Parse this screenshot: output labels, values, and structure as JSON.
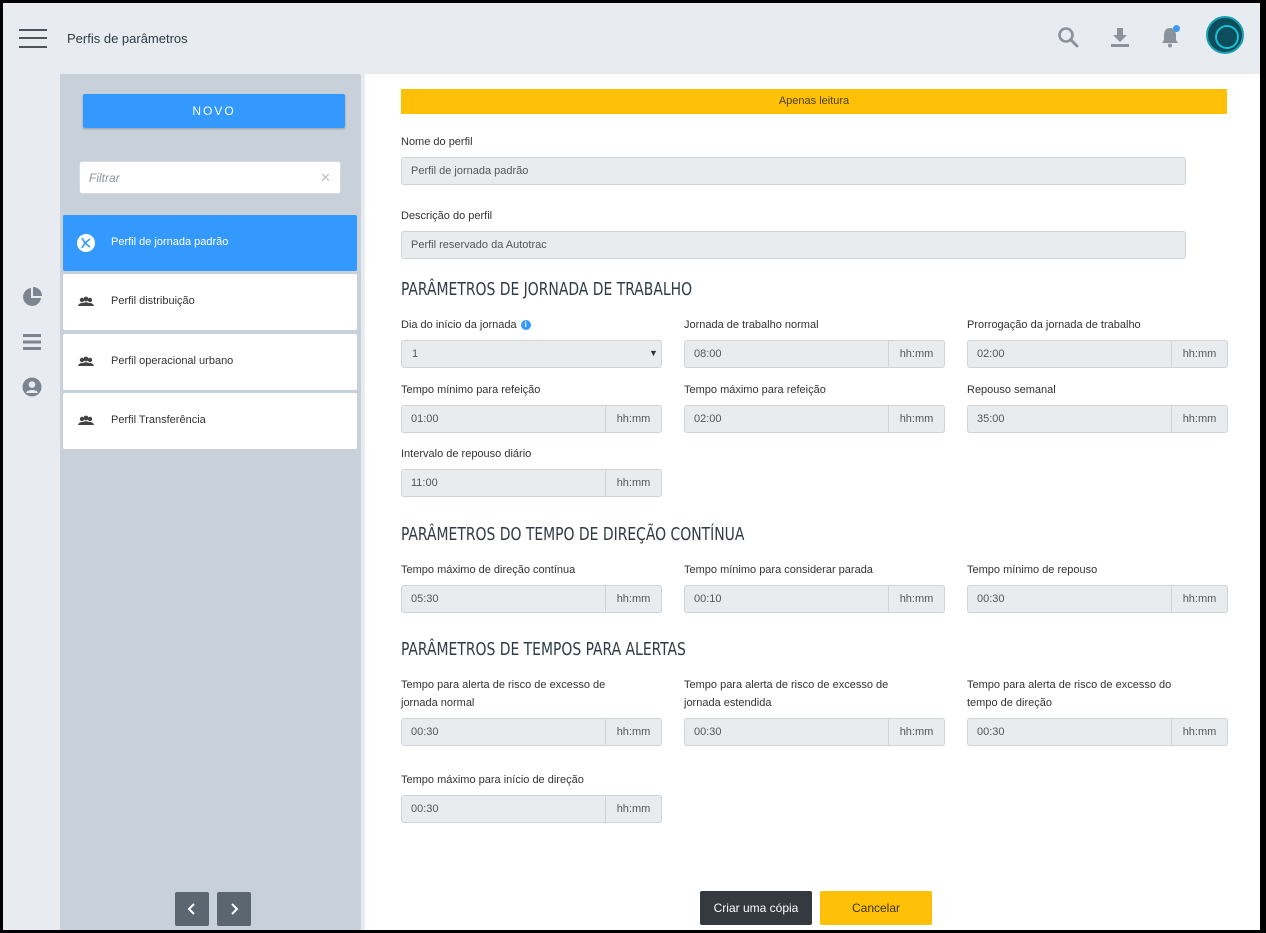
{
  "header": {
    "title": "Perfis de parâmetros",
    "icons": [
      "menu-icon",
      "search-icon",
      "download-icon",
      "bell-icon",
      "avatar"
    ]
  },
  "rail": {
    "icons": [
      "pie-chart-icon",
      "list-icon",
      "user-circle-icon"
    ]
  },
  "sidebar": {
    "new_label": "NOVO",
    "filter_placeholder": "Filtrar",
    "items": [
      {
        "label": "Perfil de jornada padrão",
        "active": true
      },
      {
        "label": "Perfil distribuição",
        "active": false
      },
      {
        "label": "Perfil operacional urbano",
        "active": false
      },
      {
        "label": "Perfil Transferência",
        "active": false
      }
    ]
  },
  "main": {
    "readonly_banner": "Apenas leitura",
    "profile_name_label": "Nome do perfil",
    "profile_name_value": "Perfil de jornada padrão",
    "profile_desc_label": "Descrição do perfil",
    "profile_desc_value": "Perfil reservado da Autotrac",
    "sections": [
      {
        "title": "PARÂMETROS DE JORNADA DE TRABALHO",
        "fields": [
          {
            "label": "Dia do início da jornada",
            "value": "1",
            "type": "select"
          },
          {
            "label": "Jornada de trabalho normal",
            "value": "08:00",
            "unit": "hh:mm"
          },
          {
            "label": "Prorrogação da jornada de trabalho",
            "value": "02:00",
            "unit": "hh:mm"
          },
          {
            "label": "Tempo mínimo para refeição",
            "value": "01:00",
            "unit": "hh:mm"
          },
          {
            "label": "Tempo máximo para refeição",
            "value": "02:00",
            "unit": "hh:mm"
          },
          {
            "label": "Repouso semanal",
            "value": "35:00",
            "unit": "hh:mm"
          },
          {
            "label": "Intervalo de repouso diário",
            "value": "11:00",
            "unit": "hh:mm"
          }
        ]
      },
      {
        "title": "PARÂMETROS DO TEMPO DE DIREÇÃO CONTÍNUA",
        "fields": [
          {
            "label": "Tempo máximo de direção contínua",
            "value": "05:30",
            "unit": "hh:mm"
          },
          {
            "label": "Tempo mínimo para considerar parada",
            "value": "00:10",
            "unit": "hh:mm"
          },
          {
            "label": "Tempo mínimo de repouso",
            "value": "00:30",
            "unit": "hh:mm"
          }
        ]
      },
      {
        "title": "PARÂMETROS DE TEMPOS PARA ALERTAS",
        "fields": [
          {
            "label1": "Tempo para alerta de risco de excesso de",
            "label2": "jornada normal",
            "value": "00:30",
            "unit": "hh:mm"
          },
          {
            "label1": "Tempo para alerta de risco de excesso de",
            "label2": "jornada estendida",
            "value": "00:30",
            "unit": "hh:mm"
          },
          {
            "label1": "Tempo para alerta de risco de excesso do",
            "label2": "tempo de direção",
            "value": "00:30",
            "unit": "hh:mm"
          },
          {
            "label": "Tempo máximo para início de direção",
            "value": "00:30",
            "unit": "hh:mm"
          }
        ]
      }
    ],
    "copy_label": "Criar uma cópia",
    "cancel_label": "Cancelar"
  },
  "colors": {
    "accent": "#3399ff",
    "warning": "#ffc107",
    "dark_button": "#343a40",
    "panel": "#c8d0d9"
  }
}
